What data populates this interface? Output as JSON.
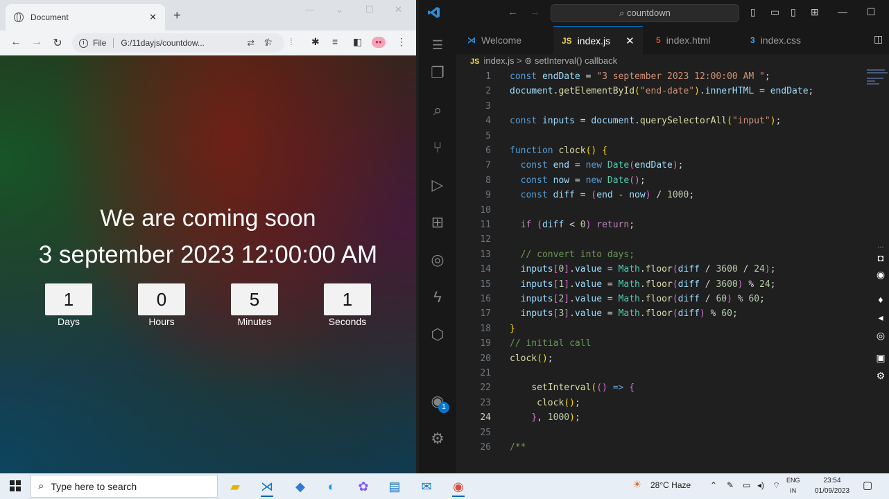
{
  "browser": {
    "tab_title": "Document",
    "tab_close": "✕",
    "new_tab": "+",
    "address_scheme": "File",
    "address_url": "G:/11dayjs/countdow...",
    "page": {
      "heading": "We are coming soon",
      "end_date": "3 september 2023 12:00:00 AM",
      "counters": [
        {
          "value": "1",
          "label": "Days"
        },
        {
          "value": "0",
          "label": "Hours"
        },
        {
          "value": "5",
          "label": "Minutes"
        },
        {
          "value": "1",
          "label": "Seconds"
        }
      ]
    }
  },
  "vscode": {
    "search_text": "countdown",
    "tabs": [
      {
        "icon": "vscode-icon",
        "label": "Welcome"
      },
      {
        "icon": "JS",
        "label": "index.js"
      },
      {
        "icon": "5",
        "label": "index.html"
      },
      {
        "icon": "3",
        "label": "index.css"
      }
    ],
    "breadcrumb": {
      "file": "index.js",
      "sep": ">",
      "symbol": "setInterval() callback"
    },
    "account_badge": "1",
    "current_line": 24,
    "code_lines": [
      [
        [
          "kw",
          "const "
        ],
        [
          "var",
          "endDate"
        ],
        [
          "op",
          " = "
        ],
        [
          "str",
          "\"3 september 2023 12:00:00 AM \""
        ],
        [
          "op",
          ";"
        ]
      ],
      [
        [
          "var",
          "document"
        ],
        [
          "op",
          "."
        ],
        [
          "fn",
          "getElementById"
        ],
        [
          "br",
          "("
        ],
        [
          "str",
          "\"end-date\""
        ],
        [
          "br",
          ")"
        ],
        [
          "op",
          "."
        ],
        [
          "var",
          "innerHTML"
        ],
        [
          "op",
          " = "
        ],
        [
          "var",
          "endDate"
        ],
        [
          "op",
          ";"
        ]
      ],
      [],
      [
        [
          "kw",
          "const "
        ],
        [
          "var",
          "inputs"
        ],
        [
          "op",
          " = "
        ],
        [
          "var",
          "document"
        ],
        [
          "op",
          "."
        ],
        [
          "fn",
          "querySelectorAll"
        ],
        [
          "br",
          "("
        ],
        [
          "str",
          "\"input\""
        ],
        [
          "br",
          ")"
        ],
        [
          "op",
          ";"
        ]
      ],
      [],
      [
        [
          "kw",
          "function "
        ],
        [
          "fn",
          "clock"
        ],
        [
          "br",
          "() {"
        ]
      ],
      [
        [
          "op",
          "  "
        ],
        [
          "kw",
          "const "
        ],
        [
          "var",
          "end"
        ],
        [
          "op",
          " = "
        ],
        [
          "kw",
          "new "
        ],
        [
          "cls",
          "Date"
        ],
        [
          "br2",
          "("
        ],
        [
          "var",
          "endDate"
        ],
        [
          "br2",
          ")"
        ],
        [
          "op",
          ";"
        ]
      ],
      [
        [
          "op",
          "  "
        ],
        [
          "kw",
          "const "
        ],
        [
          "var",
          "now"
        ],
        [
          "op",
          " = "
        ],
        [
          "kw",
          "new "
        ],
        [
          "cls",
          "Date"
        ],
        [
          "br2",
          "()"
        ],
        [
          "op",
          ";"
        ]
      ],
      [
        [
          "op",
          "  "
        ],
        [
          "kw",
          "const "
        ],
        [
          "var",
          "diff"
        ],
        [
          "op",
          " = "
        ],
        [
          "br2",
          "("
        ],
        [
          "var",
          "end"
        ],
        [
          "op",
          " - "
        ],
        [
          "var",
          "now"
        ],
        [
          "br2",
          ")"
        ],
        [
          "op",
          " / "
        ],
        [
          "num",
          "1000"
        ],
        [
          "op",
          ";"
        ]
      ],
      [],
      [
        [
          "op",
          "  "
        ],
        [
          "ctl",
          "if "
        ],
        [
          "br2",
          "("
        ],
        [
          "var",
          "diff"
        ],
        [
          "op",
          " < "
        ],
        [
          "num",
          "0"
        ],
        [
          "br2",
          ")"
        ],
        [
          "op",
          " "
        ],
        [
          "ctl",
          "return"
        ],
        [
          "op",
          ";"
        ]
      ],
      [],
      [
        [
          "op",
          "  "
        ],
        [
          "cmt",
          "// convert into days;"
        ]
      ],
      [
        [
          "op",
          "  "
        ],
        [
          "var",
          "inputs"
        ],
        [
          "br2",
          "["
        ],
        [
          "num",
          "0"
        ],
        [
          "br2",
          "]"
        ],
        [
          "op",
          "."
        ],
        [
          "var",
          "value"
        ],
        [
          "op",
          " = "
        ],
        [
          "cls",
          "Math"
        ],
        [
          "op",
          "."
        ],
        [
          "fn",
          "floor"
        ],
        [
          "br2",
          "("
        ],
        [
          "var",
          "diff"
        ],
        [
          "op",
          " / "
        ],
        [
          "num",
          "3600"
        ],
        [
          "op",
          " / "
        ],
        [
          "num",
          "24"
        ],
        [
          "br2",
          ")"
        ],
        [
          "op",
          ";"
        ]
      ],
      [
        [
          "op",
          "  "
        ],
        [
          "var",
          "inputs"
        ],
        [
          "br2",
          "["
        ],
        [
          "num",
          "1"
        ],
        [
          "br2",
          "]"
        ],
        [
          "op",
          "."
        ],
        [
          "var",
          "value"
        ],
        [
          "op",
          " = "
        ],
        [
          "cls",
          "Math"
        ],
        [
          "op",
          "."
        ],
        [
          "fn",
          "floor"
        ],
        [
          "br2",
          "("
        ],
        [
          "var",
          "diff"
        ],
        [
          "op",
          " / "
        ],
        [
          "num",
          "3600"
        ],
        [
          "br2",
          ")"
        ],
        [
          "op",
          " % "
        ],
        [
          "num",
          "24"
        ],
        [
          "op",
          ";"
        ]
      ],
      [
        [
          "op",
          "  "
        ],
        [
          "var",
          "inputs"
        ],
        [
          "br2",
          "["
        ],
        [
          "num",
          "2"
        ],
        [
          "br2",
          "]"
        ],
        [
          "op",
          "."
        ],
        [
          "var",
          "value"
        ],
        [
          "op",
          " = "
        ],
        [
          "cls",
          "Math"
        ],
        [
          "op",
          "."
        ],
        [
          "fn",
          "floor"
        ],
        [
          "br2",
          "("
        ],
        [
          "var",
          "diff"
        ],
        [
          "op",
          " / "
        ],
        [
          "num",
          "60"
        ],
        [
          "br2",
          ")"
        ],
        [
          "op",
          " % "
        ],
        [
          "num",
          "60"
        ],
        [
          "op",
          ";"
        ]
      ],
      [
        [
          "op",
          "  "
        ],
        [
          "var",
          "inputs"
        ],
        [
          "br2",
          "["
        ],
        [
          "num",
          "3"
        ],
        [
          "br2",
          "]"
        ],
        [
          "op",
          "."
        ],
        [
          "var",
          "value"
        ],
        [
          "op",
          " = "
        ],
        [
          "cls",
          "Math"
        ],
        [
          "op",
          "."
        ],
        [
          "fn",
          "floor"
        ],
        [
          "br2",
          "("
        ],
        [
          "var",
          "diff"
        ],
        [
          "br2",
          ")"
        ],
        [
          "op",
          " % "
        ],
        [
          "num",
          "60"
        ],
        [
          "op",
          ";"
        ]
      ],
      [
        [
          "br",
          "}"
        ]
      ],
      [
        [
          "cmt",
          "// initial call"
        ]
      ],
      [
        [
          "fn",
          "clock"
        ],
        [
          "br",
          "()"
        ],
        [
          "op",
          ";"
        ]
      ],
      [],
      [
        [
          "op",
          "    "
        ],
        [
          "fn",
          "setInterval"
        ],
        [
          "br",
          "("
        ],
        [
          "br2",
          "()"
        ],
        [
          "op",
          " "
        ],
        [
          "kw",
          "=>"
        ],
        [
          "op",
          " "
        ],
        [
          "br2",
          "{"
        ]
      ],
      [
        [
          "op",
          "     "
        ],
        [
          "fn",
          "clock"
        ],
        [
          "br",
          "()"
        ],
        [
          "op",
          ";"
        ]
      ],
      [
        [
          "op",
          "    "
        ],
        [
          "br2",
          "}"
        ],
        [
          "op",
          ", "
        ],
        [
          "num",
          "1000"
        ],
        [
          "br",
          ")"
        ],
        [
          "op",
          ";"
        ]
      ],
      [],
      [
        [
          "cmt",
          "/**"
        ]
      ]
    ]
  },
  "taskbar": {
    "search_placeholder": "Type here to search",
    "weather": "28°C  Haze",
    "lang_top": "ENG",
    "lang_bottom": "IN",
    "time": "23:54",
    "date": "01/09/2023"
  },
  "colors": {
    "accent": "#0078d4",
    "keyword": "#569cd6",
    "string": "#ce9178",
    "function": "#dcdcaa",
    "variable": "#9cdcfe"
  }
}
